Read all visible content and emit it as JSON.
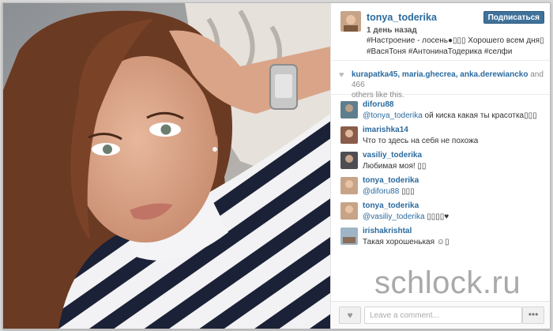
{
  "post": {
    "username": "tonya_toderika",
    "follow_label": "Подписаться",
    "time": "1 день назад",
    "caption_line1": "#Настроение - лосень●▯▯▯ Хорошего всем дня▯",
    "caption_line2": "#ВасяТоня #АнтонинаТодерика #селфи"
  },
  "likes": {
    "heart_icon": "♥",
    "users": "kurapatka45, maria.ghecrea, anka.derewiancko",
    "and": " and ",
    "count": "466",
    "suffix": "others like this."
  },
  "comments": [
    {
      "user": "diforu88",
      "mention": "@tonya_toderika",
      "text": " ой киска какая ты красотка▯▯▯"
    },
    {
      "user": "imarishka14",
      "mention": "",
      "text": "Что то здесь на себя не похожа"
    },
    {
      "user": "vasiliy_toderika",
      "mention": "",
      "text": "Любимая моя! ▯▯"
    },
    {
      "user": "tonya_toderika",
      "mention": "@diforu88",
      "text": " ▯▯▯"
    },
    {
      "user": "tonya_toderika",
      "mention": "@vasiliy_toderika",
      "text": " ▯▯▯▯♥"
    },
    {
      "user": "irishakrishtal",
      "mention": "",
      "text": "Такая хорошенькая ☺▯"
    }
  ],
  "footer": {
    "comment_placeholder": "Leave a comment...",
    "more_label": "•••"
  },
  "watermark": "schlock.ru",
  "colors": {
    "link": "#2b6a9e",
    "follow_button": "#3f729b"
  }
}
